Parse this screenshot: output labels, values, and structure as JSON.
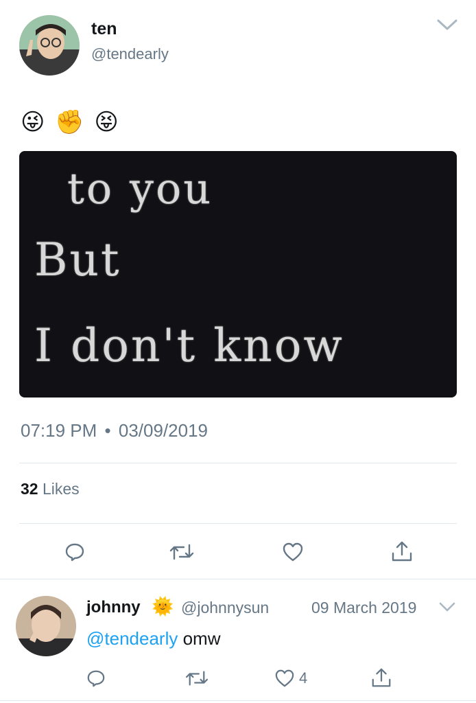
{
  "tweet": {
    "author_name": "ten",
    "author_handle": "@tendearly",
    "emoji_text": "😜 ✊ 😝",
    "media_lines": [
      "to you",
      "But",
      "I don't know"
    ],
    "time": "07:19 PM",
    "dot": "•",
    "date": "03/09/2019",
    "likes_count": "32",
    "likes_label": "Likes"
  },
  "reply": {
    "author_name": "johnny",
    "badge_emoji": "🌞",
    "author_handle": "@johnnysun",
    "date": "09 March 2019",
    "mention": "@tendearly",
    "text": "omw",
    "like_count": "4"
  },
  "colors": {
    "link": "#1da1f2",
    "gray": "#657786",
    "divider": "#e1e8ed"
  },
  "icons": [
    "chevron-down-icon",
    "reply-icon",
    "retweet-icon",
    "heart-icon",
    "share-icon"
  ]
}
